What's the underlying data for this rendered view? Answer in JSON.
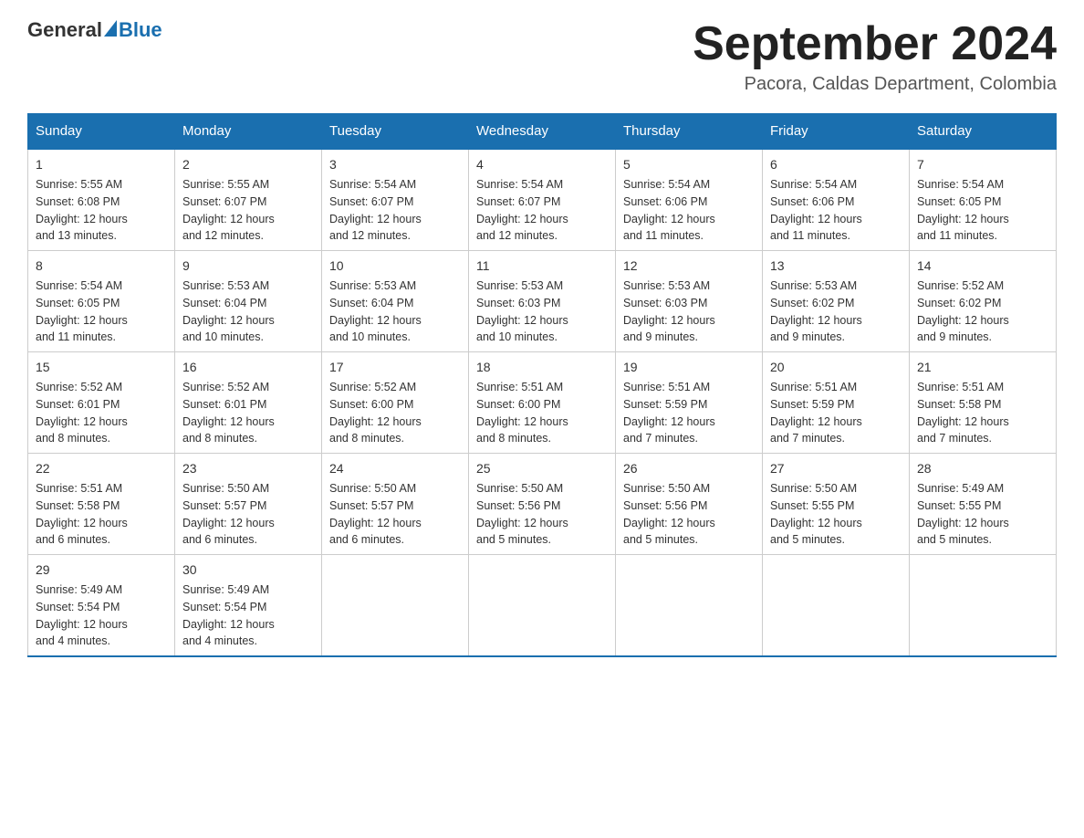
{
  "header": {
    "logo_general": "General",
    "logo_blue": "Blue",
    "month_title": "September 2024",
    "location": "Pacora, Caldas Department, Colombia"
  },
  "days_of_week": [
    "Sunday",
    "Monday",
    "Tuesday",
    "Wednesday",
    "Thursday",
    "Friday",
    "Saturday"
  ],
  "weeks": [
    [
      {
        "day": "1",
        "sunrise": "5:55 AM",
        "sunset": "6:08 PM",
        "daylight": "12 hours and 13 minutes."
      },
      {
        "day": "2",
        "sunrise": "5:55 AM",
        "sunset": "6:07 PM",
        "daylight": "12 hours and 12 minutes."
      },
      {
        "day": "3",
        "sunrise": "5:54 AM",
        "sunset": "6:07 PM",
        "daylight": "12 hours and 12 minutes."
      },
      {
        "day": "4",
        "sunrise": "5:54 AM",
        "sunset": "6:07 PM",
        "daylight": "12 hours and 12 minutes."
      },
      {
        "day": "5",
        "sunrise": "5:54 AM",
        "sunset": "6:06 PM",
        "daylight": "12 hours and 11 minutes."
      },
      {
        "day": "6",
        "sunrise": "5:54 AM",
        "sunset": "6:06 PM",
        "daylight": "12 hours and 11 minutes."
      },
      {
        "day": "7",
        "sunrise": "5:54 AM",
        "sunset": "6:05 PM",
        "daylight": "12 hours and 11 minutes."
      }
    ],
    [
      {
        "day": "8",
        "sunrise": "5:54 AM",
        "sunset": "6:05 PM",
        "daylight": "12 hours and 11 minutes."
      },
      {
        "day": "9",
        "sunrise": "5:53 AM",
        "sunset": "6:04 PM",
        "daylight": "12 hours and 10 minutes."
      },
      {
        "day": "10",
        "sunrise": "5:53 AM",
        "sunset": "6:04 PM",
        "daylight": "12 hours and 10 minutes."
      },
      {
        "day": "11",
        "sunrise": "5:53 AM",
        "sunset": "6:03 PM",
        "daylight": "12 hours and 10 minutes."
      },
      {
        "day": "12",
        "sunrise": "5:53 AM",
        "sunset": "6:03 PM",
        "daylight": "12 hours and 9 minutes."
      },
      {
        "day": "13",
        "sunrise": "5:53 AM",
        "sunset": "6:02 PM",
        "daylight": "12 hours and 9 minutes."
      },
      {
        "day": "14",
        "sunrise": "5:52 AM",
        "sunset": "6:02 PM",
        "daylight": "12 hours and 9 minutes."
      }
    ],
    [
      {
        "day": "15",
        "sunrise": "5:52 AM",
        "sunset": "6:01 PM",
        "daylight": "12 hours and 8 minutes."
      },
      {
        "day": "16",
        "sunrise": "5:52 AM",
        "sunset": "6:01 PM",
        "daylight": "12 hours and 8 minutes."
      },
      {
        "day": "17",
        "sunrise": "5:52 AM",
        "sunset": "6:00 PM",
        "daylight": "12 hours and 8 minutes."
      },
      {
        "day": "18",
        "sunrise": "5:51 AM",
        "sunset": "6:00 PM",
        "daylight": "12 hours and 8 minutes."
      },
      {
        "day": "19",
        "sunrise": "5:51 AM",
        "sunset": "5:59 PM",
        "daylight": "12 hours and 7 minutes."
      },
      {
        "day": "20",
        "sunrise": "5:51 AM",
        "sunset": "5:59 PM",
        "daylight": "12 hours and 7 minutes."
      },
      {
        "day": "21",
        "sunrise": "5:51 AM",
        "sunset": "5:58 PM",
        "daylight": "12 hours and 7 minutes."
      }
    ],
    [
      {
        "day": "22",
        "sunrise": "5:51 AM",
        "sunset": "5:58 PM",
        "daylight": "12 hours and 6 minutes."
      },
      {
        "day": "23",
        "sunrise": "5:50 AM",
        "sunset": "5:57 PM",
        "daylight": "12 hours and 6 minutes."
      },
      {
        "day": "24",
        "sunrise": "5:50 AM",
        "sunset": "5:57 PM",
        "daylight": "12 hours and 6 minutes."
      },
      {
        "day": "25",
        "sunrise": "5:50 AM",
        "sunset": "5:56 PM",
        "daylight": "12 hours and 5 minutes."
      },
      {
        "day": "26",
        "sunrise": "5:50 AM",
        "sunset": "5:56 PM",
        "daylight": "12 hours and 5 minutes."
      },
      {
        "day": "27",
        "sunrise": "5:50 AM",
        "sunset": "5:55 PM",
        "daylight": "12 hours and 5 minutes."
      },
      {
        "day": "28",
        "sunrise": "5:49 AM",
        "sunset": "5:55 PM",
        "daylight": "12 hours and 5 minutes."
      }
    ],
    [
      {
        "day": "29",
        "sunrise": "5:49 AM",
        "sunset": "5:54 PM",
        "daylight": "12 hours and 4 minutes."
      },
      {
        "day": "30",
        "sunrise": "5:49 AM",
        "sunset": "5:54 PM",
        "daylight": "12 hours and 4 minutes."
      },
      null,
      null,
      null,
      null,
      null
    ]
  ],
  "labels": {
    "sunrise": "Sunrise:",
    "sunset": "Sunset:",
    "daylight": "Daylight:"
  }
}
